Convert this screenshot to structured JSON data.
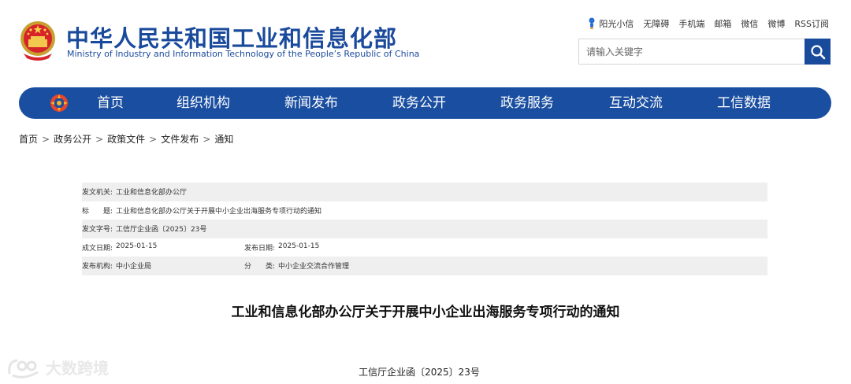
{
  "header": {
    "title_cn": "中华人民共和国工业和信息化部",
    "title_en": "Ministry of Industry and Information Technology of the People’s Republic of China",
    "emblem_icon": "national-emblem-icon",
    "top_links": [
      "阳光小信",
      "无障碍",
      "手机端",
      "邮箱",
      "微信",
      "微博",
      "RSS订阅"
    ],
    "search_placeholder": "请输入关键字",
    "search_icon": "search-icon"
  },
  "nav": {
    "logo_icon": "miit-logo-icon",
    "items": [
      "首页",
      "组织机构",
      "新闻发布",
      "政务公开",
      "政务服务",
      "互动交流",
      "工信数据"
    ]
  },
  "breadcrumb": [
    "首页",
    "政务公开",
    "政策文件",
    "文件发布",
    "通知"
  ],
  "info": {
    "issuer_label": "发文机关:",
    "issuer": "工业和信息化部办公厅",
    "title_label": "标　　题:",
    "title": "工业和信息化部办公厅关于开展中小企业出海服务专项行动的通知",
    "docno_label": "发文字号:",
    "docno": "工信厅企业函〔2025〕23号",
    "created_label": "成文日期:",
    "created": "2025-01-15",
    "published_label": "发布日期:",
    "published": "2025-01-15",
    "agency_label": "发布机构:",
    "agency": "中小企业局",
    "category_label": "分　　类:",
    "category": "中小企业交流合作管理"
  },
  "document": {
    "title": "工业和信息化部办公厅关于开展中小企业出海服务专项行动的通知",
    "number": "工信厅企业函〔2025〕23号"
  },
  "watermark": {
    "text": "大数跨境"
  },
  "colors": {
    "brand_blue": "#1a4ea0",
    "row_shade": "#efefef"
  }
}
